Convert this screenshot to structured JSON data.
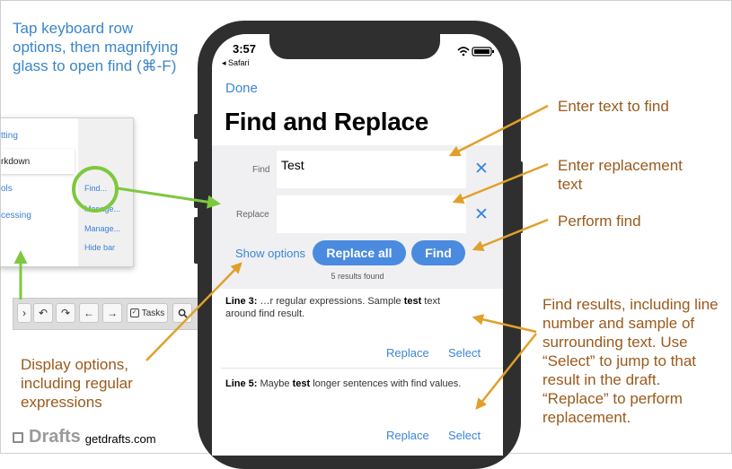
{
  "annotations": {
    "tap_keyboard": "Tap keyboard row options, then magnifying glass to open find (⌘-F)",
    "enter_find": "Enter text to find",
    "enter_replacement": "Enter replacement text",
    "perform_find": "Perform find",
    "find_results": "Find results, including line number and sample of surrounding text. Use “Select” to jump to that result in the draft. “Replace” to perform replacement.",
    "display_options": "Display options, including regular expressions"
  },
  "menu": {
    "left_items": [
      "tting",
      "rkdown",
      "ols",
      "cessing"
    ],
    "right_items": [
      "Find...",
      "Manage...",
      "Manage...",
      "Hide bar"
    ]
  },
  "keyboard_row": {
    "tasks_label": "Tasks",
    "icons": [
      "chevron-right-icon",
      "undo-icon",
      "redo-icon",
      "arrow-left-icon",
      "arrow-right-icon",
      "tasks-checkbox-icon",
      "search-icon"
    ]
  },
  "status": {
    "time": "3:57",
    "back_app": "◂ Safari"
  },
  "nav": {
    "done": "Done",
    "title": "Find and Replace"
  },
  "find_field": {
    "label": "Find",
    "value": "Test"
  },
  "replace_field": {
    "label": "Replace",
    "value": ""
  },
  "actions": {
    "show_options": "Show options",
    "replace_all": "Replace all",
    "find": "Find"
  },
  "results_count": "5 results found",
  "results": [
    {
      "line": "Line 3:",
      "before": " …r regular expressions. Sample ",
      "match": "test",
      "after": " text around find result.",
      "replace": "Replace",
      "select": "Select"
    },
    {
      "line": "Line 5:",
      "before": " Maybe ",
      "match": "test",
      "after": " longer sentences with find values.",
      "replace": "Replace",
      "select": "Select"
    }
  ],
  "brand": {
    "name": "Drafts",
    "url": "getdrafts.com"
  },
  "colors": {
    "accent_blue": "#3a86d8",
    "annotation_blue": "#3a86c8",
    "annotation_orange": "#9a5a1c",
    "arrow_orange": "#e0a02a",
    "arrow_green": "#7ec83e",
    "phone_frame": "#2f2f2f"
  }
}
